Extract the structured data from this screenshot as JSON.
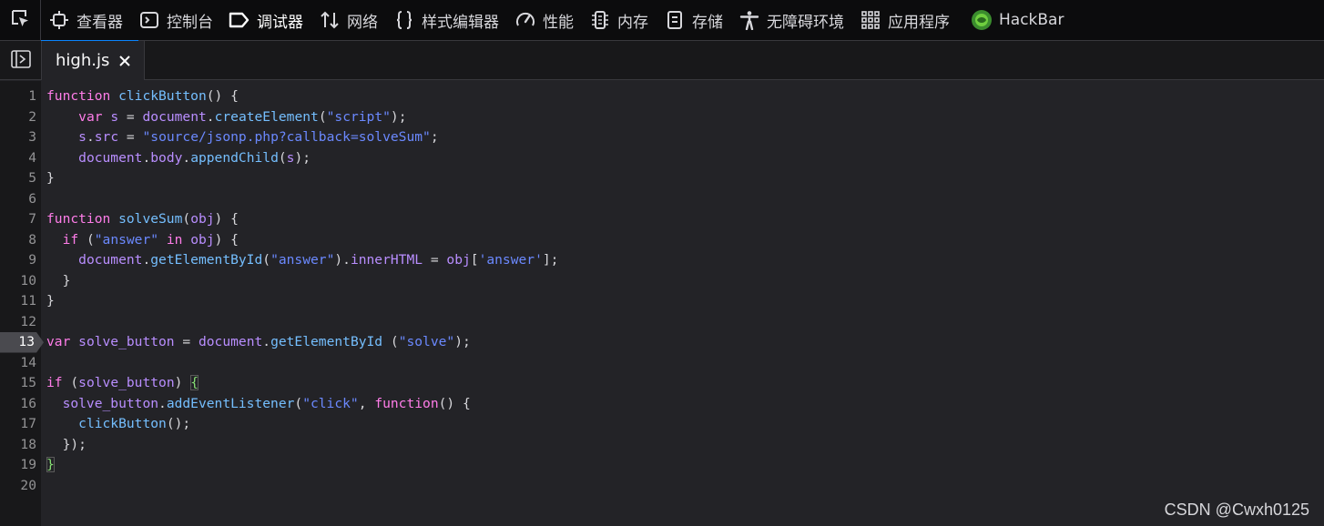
{
  "toolbar": {
    "tabs": [
      {
        "label": "查看器",
        "icon": "inspector-icon"
      },
      {
        "label": "控制台",
        "icon": "console-icon"
      },
      {
        "label": "调试器",
        "icon": "debugger-icon",
        "active": true
      },
      {
        "label": "网络",
        "icon": "network-icon"
      },
      {
        "label": "样式编辑器",
        "icon": "style-editor-icon"
      },
      {
        "label": "性能",
        "icon": "performance-icon"
      },
      {
        "label": "内存",
        "icon": "memory-icon"
      },
      {
        "label": "存储",
        "icon": "storage-icon"
      },
      {
        "label": "无障碍环境",
        "icon": "accessibility-icon"
      },
      {
        "label": "应用程序",
        "icon": "application-icon"
      },
      {
        "label": "HackBar",
        "icon": "hackbar-icon"
      }
    ]
  },
  "source_tab": {
    "filename": "high.js"
  },
  "editor": {
    "breakpoint_line": "13",
    "lines": [
      {
        "n": "1",
        "code": "function clickButton() {"
      },
      {
        "n": "2",
        "code": "    var s = document.createElement(\"script\");"
      },
      {
        "n": "3",
        "code": "    s.src = \"source/jsonp.php?callback=solveSum\";"
      },
      {
        "n": "4",
        "code": "    document.body.appendChild(s);"
      },
      {
        "n": "5",
        "code": "}"
      },
      {
        "n": "6",
        "code": ""
      },
      {
        "n": "7",
        "code": "function solveSum(obj) {"
      },
      {
        "n": "8",
        "code": "  if (\"answer\" in obj) {"
      },
      {
        "n": "9",
        "code": "    document.getElementById(\"answer\").innerHTML = obj['answer'];"
      },
      {
        "n": "10",
        "code": "  }"
      },
      {
        "n": "11",
        "code": "}"
      },
      {
        "n": "12",
        "code": ""
      },
      {
        "n": "13",
        "code": "var solve_button = document.getElementById (\"solve\");"
      },
      {
        "n": "14",
        "code": ""
      },
      {
        "n": "15",
        "code": "if (solve_button) {"
      },
      {
        "n": "16",
        "code": "  solve_button.addEventListener(\"click\", function() {"
      },
      {
        "n": "17",
        "code": "    clickButton();"
      },
      {
        "n": "18",
        "code": "  });"
      },
      {
        "n": "19",
        "code": "}"
      },
      {
        "n": "20",
        "code": ""
      }
    ]
  },
  "watermark": "CSDN @Cwxh0125"
}
